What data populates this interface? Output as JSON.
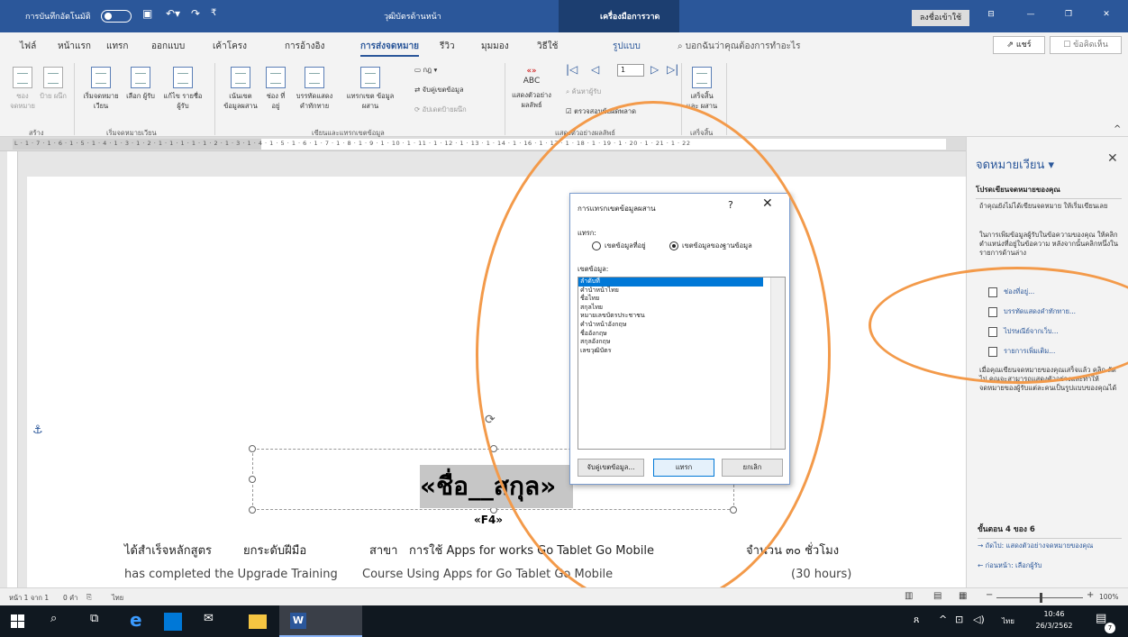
{
  "titlebar": {
    "autosave": "การบันทึกอัตโนมัติ",
    "doc_title": "วุฒิบัตรด้านหน้า",
    "tools_tab": "เครื่องมือการวาด",
    "signin": "ลงชื่อเข้าใช้",
    "quick_access_icons": [
      "save-icon",
      "undo-icon",
      "redo-icon",
      "customize-icon"
    ]
  },
  "tabs": [
    "ไฟล์",
    "หน้าแรก",
    "แทรก",
    "ออกแบบ",
    "เค้าโครง",
    "การอ้างอิง",
    "การส่งจดหมาย",
    "รีวิว",
    "มุมมอง",
    "วิธีใช้",
    "รูปแบบ"
  ],
  "active_tab": "การส่งจดหมาย",
  "tell_me": "บอกฉันว่าคุณต้องการทำอะไร",
  "share": "แชร์",
  "comments": "ข้อคิดเห็น",
  "ribbon": {
    "create": {
      "envelopes": "ซอง จดหมาย",
      "labels": "ป้าย ผนึก",
      "group": "สร้าง"
    },
    "start": {
      "start_merge": "เริ่มจดหมาย เวียน",
      "select_recipients": "เลือก ผู้รับ",
      "edit_list": "แก้ไข รายชื่อผู้รับ",
      "group": "เริ่มจดหมายเวียน"
    },
    "write": {
      "highlight": "เน้นเขต ข้อมูลผสาน",
      "address_block": "ช่อง ที่อยู่",
      "greeting": "บรรทัดแสดง คำทักทาย",
      "insert_field": "แทรกเขต ข้อมูลผสาน",
      "rules": "กฎ",
      "match_fields": "จับคู่เขตข้อมูล",
      "update_labels": "อัปเดตป้ายผนึก",
      "group": "เขียนและแทรกเขตข้อมูล"
    },
    "preview": {
      "preview_results": "แสดงตัวอย่าง ผลลัพธ์",
      "abc": "ABC",
      "record": "1",
      "find_recipient": "ค้นหาผู้รับ",
      "check_errors": "ตรวจสอบข้อผิดพลาด",
      "group": "แสดงตัวอย่างผลลัพธ์"
    },
    "finish": {
      "finish_merge": "เสร็จสิ้นและ ผสาน",
      "group": "เสร็จสิ้น"
    }
  },
  "ruler": {
    "scale": "L · 1 · 7 · 1 · 6 · 1 · 5 · 1 · 4 · 1 · 3 · 1 · 2 · 1 · 1 · 1 · 1 · 1 · 2 · 1 · 3 · 1 · 4 · 1 · 5 · 1 · 6 · 1 · 7 · 1 · 8 · 1 · 9 · 1 · 10 · 1 · 11 · 1 · 12 · 1 · 13 · 1 · 14 · 1 · 16 · 1 · 17 · 1 · 18 · 1 · 19 · 1 · 20 · 1 · 21 · 1 · 22"
  },
  "document": {
    "merge_field": "«ชื่อ__สกุล»",
    "f4": "«F4»",
    "line1_a": "ได้สำเร็จหลักสูตร",
    "line1_b": "ยกระดับฝีมือ",
    "line1_c": "สาขา",
    "line1_d": "การใช้ Apps for works Go Tablet Go Mobile",
    "line1_e": "จำนวน ๓๐ ชั่วโมง",
    "line2_a": "has completed  the  Upgrade Training",
    "line2_b": "Course Using Apps for Go Tablet Go Mobile",
    "line2_c": "(30  hours)"
  },
  "dialog": {
    "title": "การแทรกเขตข้อมูลผสาน",
    "help": "?",
    "insert_label": "แทรก:",
    "radio_address": "เขตข้อมูลที่อยู่",
    "radio_database": "เขตข้อมูลของฐานข้อมูล",
    "fields_label": "เขตข้อมูล:",
    "fields": [
      "ลำดับที่",
      "คำนำหน้าไทย",
      "ชื่อไทย",
      "สกุลไทย",
      "หมายเลขบัตรประชาชน",
      "คำนำหน้าอังกฤษ",
      "ชื่ออังกฤษ",
      "สกุลอังกฤษ",
      "เลขวุฒิบัตร"
    ],
    "match_btn": "จับคู่เขตข้อมูล...",
    "insert_btn": "แทรก",
    "cancel_btn": "ยกเลิก"
  },
  "pane": {
    "title": "จดหมายเวียน",
    "heading": "โปรดเขียนจดหมายของคุณ",
    "p1": "ถ้าคุณยังไม่ได้เขียนจดหมาย ให้เริ่มเขียนเลย",
    "p2": "ในการเพิ่มข้อมูลผู้รับในข้อความของคุณ ให้คลิกตำแหน่งที่อยู่ในข้อความ หลังจากนั้นคลิกหนึ่งในรายการด้านล่าง",
    "links": [
      "ช่องที่อยู่...",
      "บรรทัดแสดงคำทักทาย...",
      "ไปรษณีย์จากเว็บ...",
      "รายการเพิ่มเติม..."
    ],
    "p3": "เมื่อคุณเขียนจดหมายของคุณเสร็จแล้ว คลิก ถัดไป คุณจะสามารถแสดงตัวอย่างและทำให้จดหมายของผู้รับแต่ละคนเป็นรูปแบบของคุณได้",
    "step": "ขั้นตอน 4 ของ 6",
    "next": "ถัดไป: แสดงตัวอย่างจดหมายของคุณ",
    "prev": "ก่อนหน้า: เลือกผู้รับ"
  },
  "status": {
    "page": "หน้า 1 จาก 1",
    "words": "0 คำ",
    "lang": "ไทย",
    "zoom": "100%",
    "zoom_minus": "−",
    "zoom_plus": "+"
  },
  "taskbar": {
    "time": "10:46",
    "date": "26/3/2562",
    "lang": "ไทย",
    "notifications": "7"
  }
}
